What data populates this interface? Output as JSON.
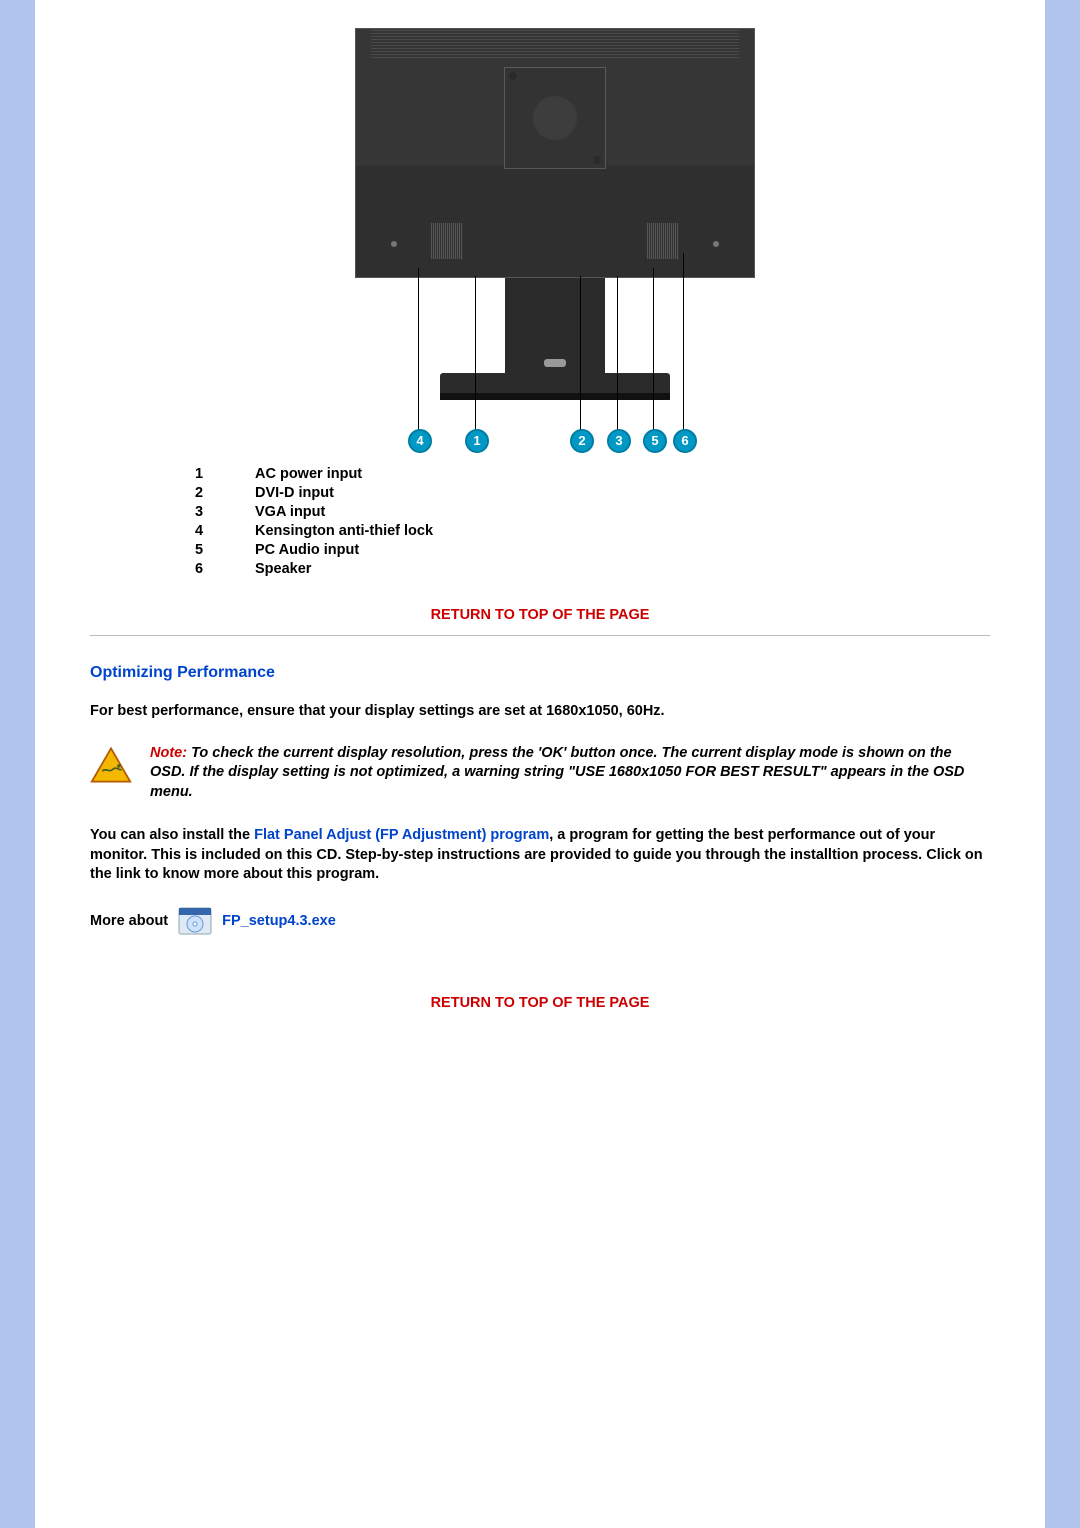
{
  "diagram": {
    "callouts": [
      "4",
      "1",
      "2",
      "3",
      "5",
      "6"
    ]
  },
  "legend": [
    {
      "num": "1",
      "label": "AC power input"
    },
    {
      "num": "2",
      "label": "DVI-D input"
    },
    {
      "num": "3",
      "label": "VGA input"
    },
    {
      "num": "4",
      "label": "Kensington anti-thief lock"
    },
    {
      "num": "5",
      "label": "PC Audio input"
    },
    {
      "num": "6",
      "label": "Speaker"
    }
  ],
  "links": {
    "return_top": "RETURN TO TOP OF THE PAGE",
    "fp_adjust": "Flat Panel Adjust (FP Adjustment) program",
    "fp_exe": "FP_setup4.3.exe"
  },
  "section": {
    "heading": "Optimizing Performance",
    "intro": "For best performance, ensure that your display settings are set at 1680x1050, 60Hz.",
    "note_prefix": "Note:",
    "note_body": " To check the current display resolution, press the 'OK' button once. The current display mode is shown on the OSD. If the display setting is not optimized, a warning string \"USE 1680x1050 FOR BEST RESULT\" appears in the OSD menu.",
    "para2_pre": "You can also install the ",
    "para2_post": ", a program for getting the best performance out of your monitor. This is included on this CD. Step-by-step instructions are provided to guide you through the installtion process. Click on the link to know more about this program.",
    "more_about": "More about"
  }
}
